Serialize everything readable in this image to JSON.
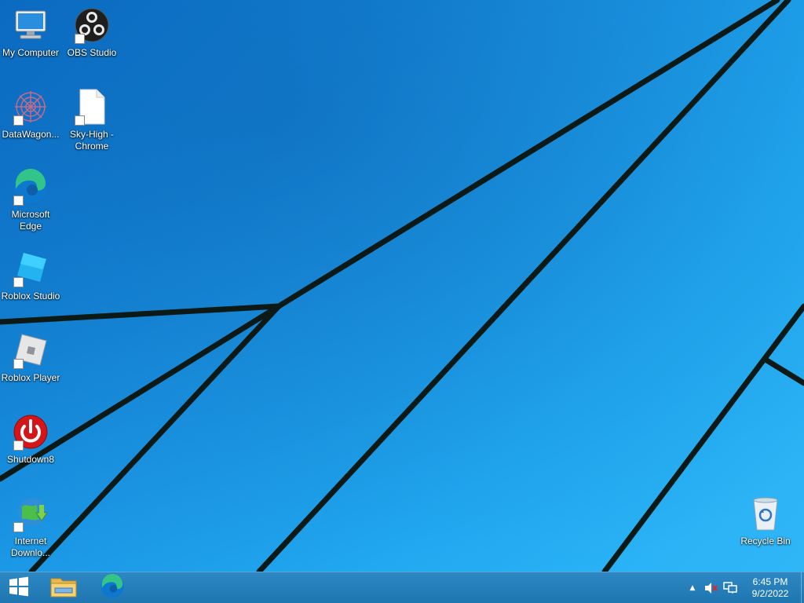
{
  "desktop": {
    "icons": [
      {
        "id": "my-computer",
        "label": "My Computer",
        "shortcut": false,
        "icon": "computer-icon"
      },
      {
        "id": "obs-studio",
        "label": "OBS Studio",
        "shortcut": true,
        "icon": "obs-icon"
      },
      {
        "id": "datawagon",
        "label": "DataWagon...",
        "shortcut": true,
        "icon": "datawagon-icon"
      },
      {
        "id": "sky-high-chrome",
        "label": "Sky-High - Chrome",
        "shortcut": true,
        "icon": "blank-file-icon"
      },
      {
        "id": "microsoft-edge",
        "label": "Microsoft Edge",
        "shortcut": true,
        "icon": "edge-icon"
      },
      {
        "id": "roblox-studio",
        "label": "Roblox Studio",
        "shortcut": true,
        "icon": "roblox-studio-icon"
      },
      {
        "id": "roblox-player",
        "label": "Roblox Player",
        "shortcut": true,
        "icon": "roblox-player-icon"
      },
      {
        "id": "shutdown8",
        "label": "Shutdown8",
        "shortcut": true,
        "icon": "power-icon"
      },
      {
        "id": "internet-download",
        "label": "Internet Downlo...",
        "shortcut": true,
        "icon": "idm-icon"
      },
      {
        "id": "recycle-bin",
        "label": "Recycle Bin",
        "shortcut": false,
        "icon": "recycle-bin-icon"
      }
    ]
  },
  "taskbar": {
    "start_icon": "windows-logo-icon",
    "pinned": [
      {
        "id": "file-explorer",
        "icon": "folder-icon"
      },
      {
        "id": "edge",
        "icon": "edge-icon"
      }
    ],
    "tray": {
      "chevron_icon": "chevron-up-icon",
      "volume_icon": "volume-muted-icon",
      "network_icon": "network-icon"
    },
    "clock": {
      "time": "6:45 PM",
      "date": "9/2/2022"
    }
  },
  "colors": {
    "wallpaper_light": "#2fb6f7",
    "wallpaper_dark": "#0a6fc9",
    "taskbar": "#2281bd"
  }
}
